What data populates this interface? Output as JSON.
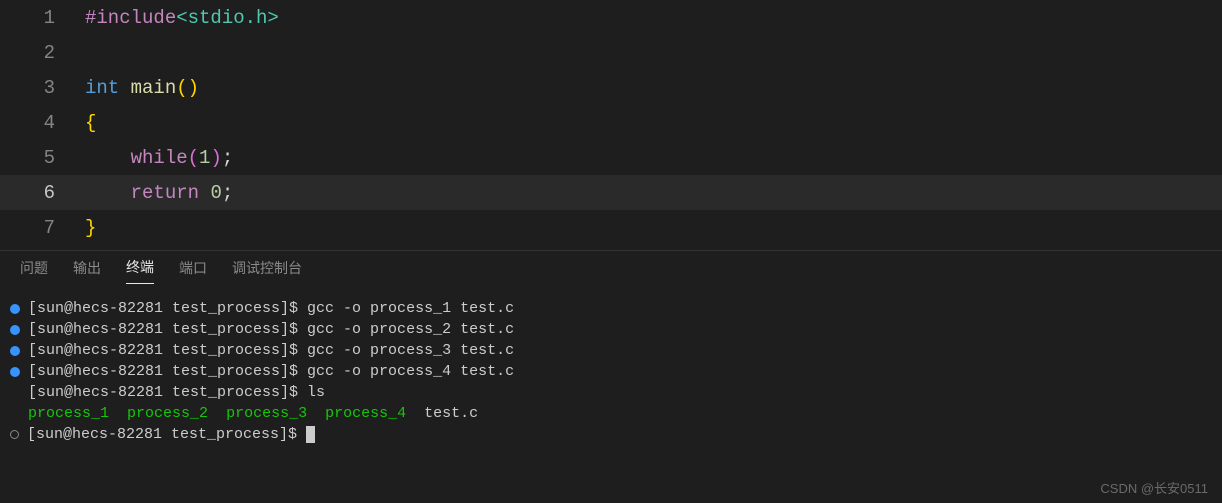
{
  "editor": {
    "lines": [
      {
        "num": "1",
        "tokens": [
          {
            "t": "#include",
            "c": "tok-directive"
          },
          {
            "t": "<stdio.h>",
            "c": "tok-include-lib"
          }
        ]
      },
      {
        "num": "2",
        "tokens": []
      },
      {
        "num": "3",
        "tokens": [
          {
            "t": "int ",
            "c": "tok-keyword"
          },
          {
            "t": "main",
            "c": "tok-func"
          },
          {
            "t": "()",
            "c": "tok-bracket-yellow"
          }
        ]
      },
      {
        "num": "4",
        "tokens": [
          {
            "t": "{",
            "c": "tok-bracket-yellow"
          }
        ]
      },
      {
        "num": "5",
        "tokens": [
          {
            "t": "    ",
            "c": "tok-text"
          },
          {
            "t": "while",
            "c": "tok-control"
          },
          {
            "t": "(",
            "c": "tok-bracket-pink"
          },
          {
            "t": "1",
            "c": "tok-number"
          },
          {
            "t": ")",
            "c": "tok-bracket-pink"
          },
          {
            "t": ";",
            "c": "tok-punct"
          }
        ]
      },
      {
        "num": "6",
        "tokens": [
          {
            "t": "    ",
            "c": "tok-text"
          },
          {
            "t": "return ",
            "c": "tok-control"
          },
          {
            "t": "0",
            "c": "tok-number"
          },
          {
            "t": ";",
            "c": "tok-punct"
          }
        ],
        "active": true
      },
      {
        "num": "7",
        "tokens": [
          {
            "t": "}",
            "c": "tok-bracket-yellow"
          }
        ]
      }
    ]
  },
  "panel": {
    "tabs": [
      {
        "label": "问题",
        "active": false
      },
      {
        "label": "输出",
        "active": false
      },
      {
        "label": "终端",
        "active": true
      },
      {
        "label": "端口",
        "active": false
      },
      {
        "label": "调试控制台",
        "active": false
      }
    ]
  },
  "terminal": {
    "prompt": "[sun@hecs-82281 test_process]$ ",
    "lines": [
      {
        "bullet": "filled",
        "cmd": "gcc -o process_1 test.c"
      },
      {
        "bullet": "filled",
        "cmd": "gcc -o process_2 test.c"
      },
      {
        "bullet": "filled",
        "cmd": "gcc -o process_3 test.c"
      },
      {
        "bullet": "filled",
        "cmd": "gcc -o process_4 test.c"
      },
      {
        "bullet": "none",
        "cmd": "ls"
      }
    ],
    "ls_output": {
      "executables": [
        "process_1",
        "process_2",
        "process_3",
        "process_4"
      ],
      "files": [
        "test.c"
      ]
    },
    "cursor_line": {
      "bullet": "outline",
      "cmd": ""
    }
  },
  "watermark": "CSDN @长安0511"
}
